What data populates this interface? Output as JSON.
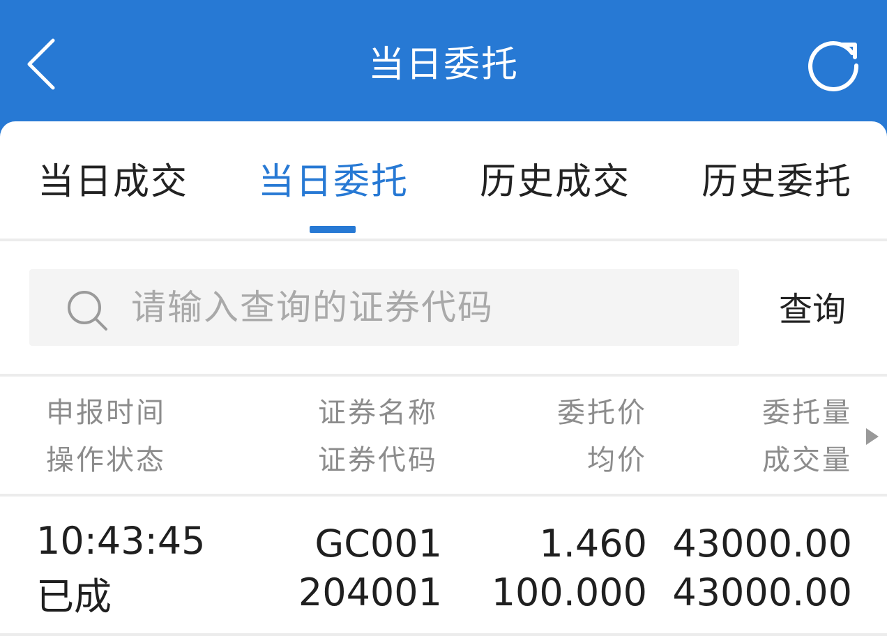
{
  "header": {
    "title": "当日委托"
  },
  "tabs": [
    {
      "label": "当日成交"
    },
    {
      "label": "当日委托"
    },
    {
      "label": "历史成交"
    },
    {
      "label": "历史委托"
    }
  ],
  "search": {
    "placeholder": "请输入查询的证券代码",
    "value": "",
    "button_label": "查询"
  },
  "table": {
    "headers": {
      "time": "申报时间",
      "status": "操作状态",
      "sec_name": "证券名称",
      "sec_code": "证券代码",
      "price": "委托价",
      "avg_price": "均价",
      "qty": "委托量",
      "deal_qty": "成交量"
    },
    "rows": [
      {
        "time": "10:43:45",
        "status": "已成",
        "sec_name": "GC001",
        "sec_code": "204001",
        "price": "1.460",
        "avg_price": "100.000",
        "qty": "43000.00",
        "deal_qty": "43000.00"
      }
    ]
  },
  "colors": {
    "brand_blue": "#2779d4",
    "text_dark": "#1f1f1f",
    "text_muted": "#8c8c8c"
  },
  "icons": {
    "back": "chevron-left-icon",
    "refresh": "refresh-icon",
    "search": "search-icon",
    "scroll": "triangle-right-icon"
  }
}
